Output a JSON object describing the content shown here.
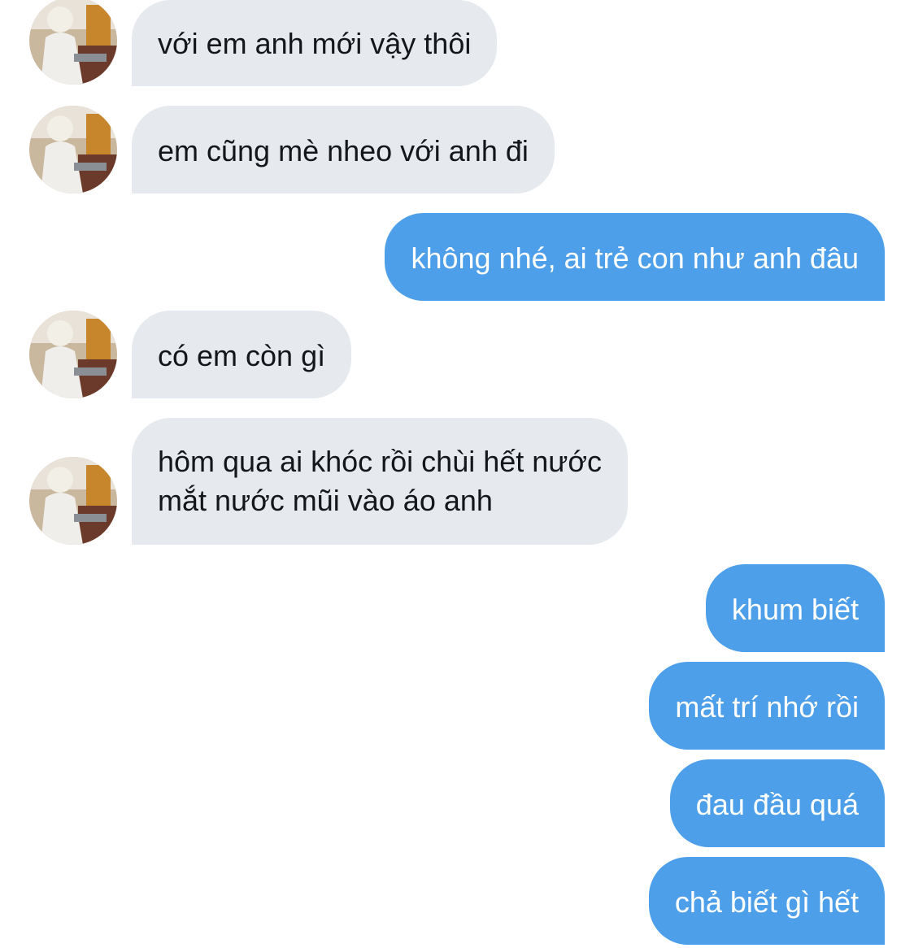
{
  "conversation": {
    "messages": [
      {
        "from": "them",
        "text": "với em anh mới vậy thôi"
      },
      {
        "from": "them",
        "text": "em cũng mè nheo với anh đi"
      },
      {
        "from": "me",
        "text": "không nhé, ai trẻ con như anh đâu"
      },
      {
        "from": "them",
        "text": "có em còn gì"
      },
      {
        "from": "them",
        "line1": "hôm qua ai khóc rồi chùi hết nước",
        "line2": "mắt nước mũi vào áo anh"
      },
      {
        "from": "me",
        "text": "khum biết"
      },
      {
        "from": "me",
        "text": "mất trí nhớ rồi"
      },
      {
        "from": "me",
        "text": "đau đầu quá"
      },
      {
        "from": "me",
        "text": "chả biết gì hết"
      }
    ]
  },
  "colors": {
    "incoming_bubble": "#e6e9ed",
    "outgoing_bubble": "#4d9fea",
    "incoming_text": "#14171a",
    "outgoing_text": "#ffffff",
    "background": "#ffffff"
  },
  "icons": {
    "avatar": "user-avatar-photo"
  }
}
